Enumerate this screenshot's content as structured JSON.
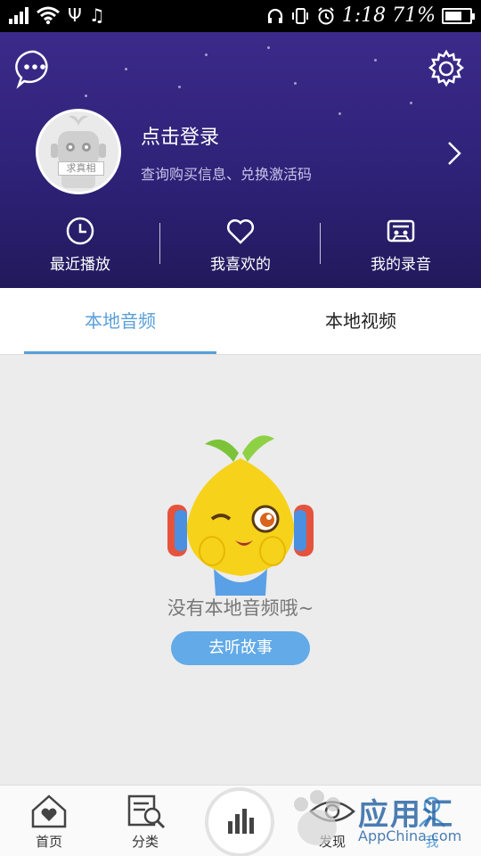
{
  "status_bar": {
    "time_battery": "1:18 71%",
    "icons": [
      "signal-icon",
      "wifi-icon",
      "usb-icon",
      "music-icon",
      "headphones-icon",
      "vibrate-icon",
      "alarm-icon",
      "battery-icon"
    ],
    "battery_level": 0.71
  },
  "header": {
    "avatar_badge": "求真相",
    "login_title": "点击登录",
    "login_subtitle": "查询购买信息、兑换激活码",
    "quick_actions": [
      {
        "label": "最近播放",
        "icon": "clock-icon"
      },
      {
        "label": "我喜欢的",
        "icon": "heart-icon"
      },
      {
        "label": "我的录音",
        "icon": "cassette-icon"
      }
    ]
  },
  "tabs": [
    {
      "label": "本地音频",
      "active": true
    },
    {
      "label": "本地视频",
      "active": false
    }
  ],
  "empty_state": {
    "message": "没有本地音频哦~",
    "button_label": "去听故事"
  },
  "bottom_nav": [
    {
      "label": "首页",
      "icon": "home-icon"
    },
    {
      "label": "分类",
      "icon": "category-icon"
    },
    {
      "label": "发现",
      "icon": "eye-icon"
    },
    {
      "label": "我",
      "icon": "user-icon"
    }
  ],
  "watermark": {
    "big": "应用汇",
    "small": "AppChina.com"
  },
  "colors": {
    "header": "#2e2278",
    "accent": "#5a9fd8",
    "button": "#62aae8"
  }
}
